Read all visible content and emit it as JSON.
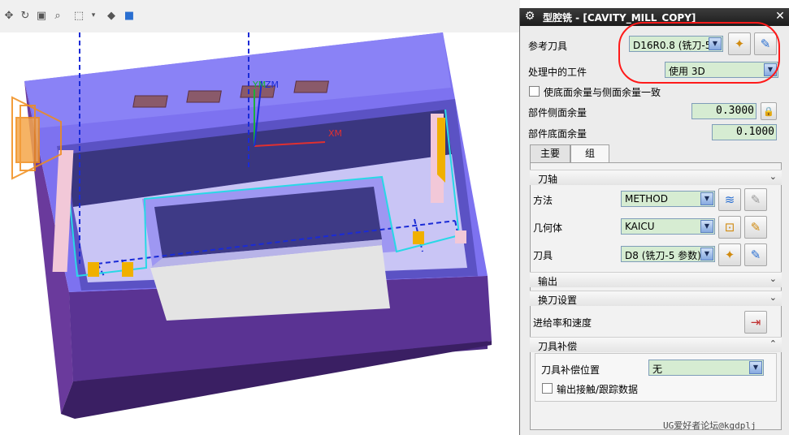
{
  "viewport": {
    "toolbar_icons": [
      "pan-icon",
      "rotate-icon",
      "fit-view-icon",
      "zoom-icon",
      "select-box-icon",
      "dropdown-arrow-icon",
      "shaded-view-icon",
      "cube-icon"
    ],
    "axis_labels": {
      "ym": "YM",
      "zm": "ZM",
      "xm": "XM"
    },
    "colors": {
      "part_top": "#7d72f0",
      "part_side": "#4a2a7e",
      "cavity": "#3b3783",
      "floor": "#e6e6e6",
      "toolpath": "#1a2bd6",
      "tool_handle": "#f08c1a"
    }
  },
  "dialog": {
    "title": "型腔铣 - [CAVITY_MILL_COPY]",
    "gear_icon": "gear-icon",
    "close_icon": "close-icon",
    "ref_tool_label": "参考刀具",
    "ref_tool_value": "D16R0.8 (铣刀-5",
    "ipw_label": "处理中的工件",
    "ipw_value": "使用 3D",
    "floor_same_as_side_label": "使底面余量与侧面余量一致",
    "part_side_stock_label": "部件侧面余量",
    "part_side_stock_value": "0.3000",
    "part_floor_stock_label": "部件底面余量",
    "part_floor_stock_value": "0.1000",
    "tabs": [
      {
        "label": "主要"
      },
      {
        "label": "组"
      }
    ],
    "sections": {
      "tool_axis": "刀轴",
      "output": "输出",
      "tool_change": "换刀设置",
      "tool_comp": "刀具补偿"
    },
    "method_label": "方法",
    "method_value": "METHOD",
    "geometry_label": "几何体",
    "geometry_value": "KAICU",
    "tool_label": "刀具",
    "tool_value": "D8 (铣刀-5 参数)",
    "feeds_label": "进给率和速度",
    "comp_position_label": "刀具补偿位置",
    "comp_position_value": "无",
    "output_contact_label": "输出接触/跟踪数据",
    "highlight_color": "#ff1a1a"
  },
  "watermark": "UG爱好者论坛@kgdplj"
}
